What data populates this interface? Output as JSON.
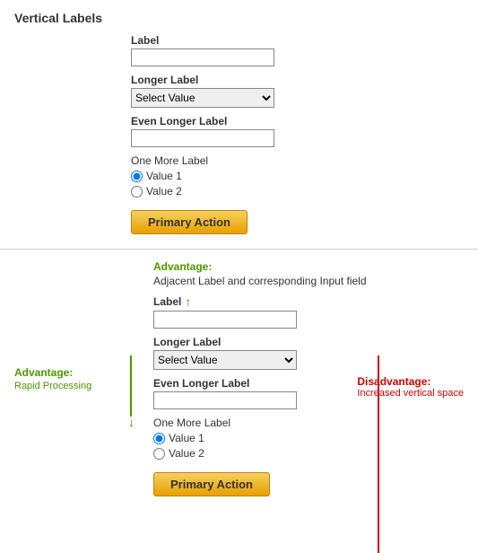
{
  "section1": {
    "title": "Vertical Labels",
    "label_field": "Label",
    "longer_label": "Longer Label",
    "even_longer_label": "Even Longer Label",
    "one_more_label": "One More Label",
    "value1": "Value 1",
    "value2": "Value 2",
    "select_placeholder": "Select Value",
    "primary_action": "Primary Action"
  },
  "section2": {
    "advantage_top_label": "Advantage:",
    "advantage_top_sub": "Adjacent Label and corresponding Input field",
    "advantage_left_label": "Advantage:",
    "advantage_left_sub": "Rapid Processing",
    "disadvantage_label": "Disadvantage:",
    "disadvantage_sub": "Increased vertical space",
    "label_field": "Label",
    "longer_label": "Longer Label",
    "even_longer_label": "Even Longer Label",
    "one_more_label": "One More Label",
    "value1": "Value 1",
    "value2": "Value 2",
    "select_placeholder": "Select Value",
    "primary_action": "Primary Action"
  }
}
